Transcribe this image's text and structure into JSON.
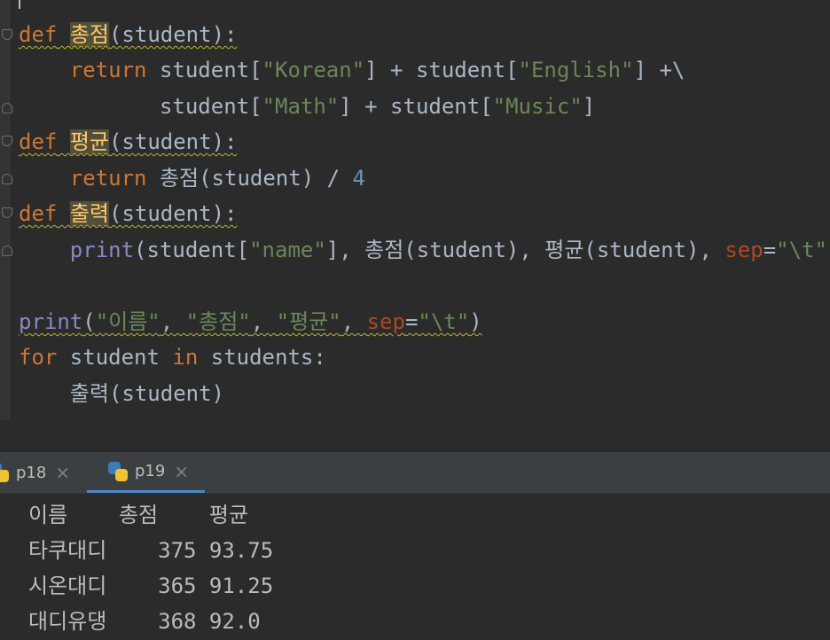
{
  "editor": {
    "code": {
      "l1": {
        "def": "def",
        "name": "총점",
        "rest": "(student):"
      },
      "l2": {
        "ret": "return",
        "a": "student[",
        "s1": "\"Korean\"",
        "b": "] + student[",
        "s2": "\"English\"",
        "c": "] +\\"
      },
      "l3": {
        "a": "student[",
        "s1": "\"Math\"",
        "b": "] + student[",
        "s2": "\"Music\"",
        "c": "]"
      },
      "l4": {
        "def": "def",
        "name": "평균",
        "rest": "(student):"
      },
      "l5": {
        "ret": "return",
        "a": " 총점(student) / ",
        "n": "4"
      },
      "l6": {
        "def": "def",
        "name": "출력",
        "rest": "(student):"
      },
      "l7": {
        "print": "print",
        "a": "(student[",
        "s1": "\"name\"",
        "b": "], 총점(student), 평균(student), ",
        "p": "sep",
        "eq": "=",
        "s2": "\"\\t\"",
        "c": ")"
      },
      "l9": {
        "print": "print",
        "a": "(",
        "s1": "\"이름\"",
        "c1": ", ",
        "s2": "\"총점\"",
        "c2": ", ",
        "s3": "\"평균\"",
        "c3": ", ",
        "p": "sep",
        "eq": "=",
        "s4": "\"\\t\"",
        "e": ")"
      },
      "l10": {
        "for": "for",
        "a": " student ",
        "in": "in",
        "b": " students:"
      },
      "l11": {
        "a": "출력(student)"
      }
    }
  },
  "tabs": [
    {
      "label": "p18",
      "close": "×"
    },
    {
      "label": "p19",
      "close": "×"
    }
  ],
  "console": {
    "header": "이름    총점    평균",
    "rows": [
      "타쿠대디    375 93.75",
      "시온대디    365 91.25",
      "대디유댕    368 92.0"
    ]
  },
  "colors": {
    "background": "#2b2b2b",
    "keyword": "#cc7832",
    "string": "#6a8759",
    "number": "#6897bb",
    "builtin": "#8888c6",
    "function_def": "#ffc66d",
    "tab_accent": "#4a88c7"
  },
  "icons": {
    "tab": "python-file-icon",
    "fold": "fold-marker-icon",
    "close": "close-icon"
  }
}
